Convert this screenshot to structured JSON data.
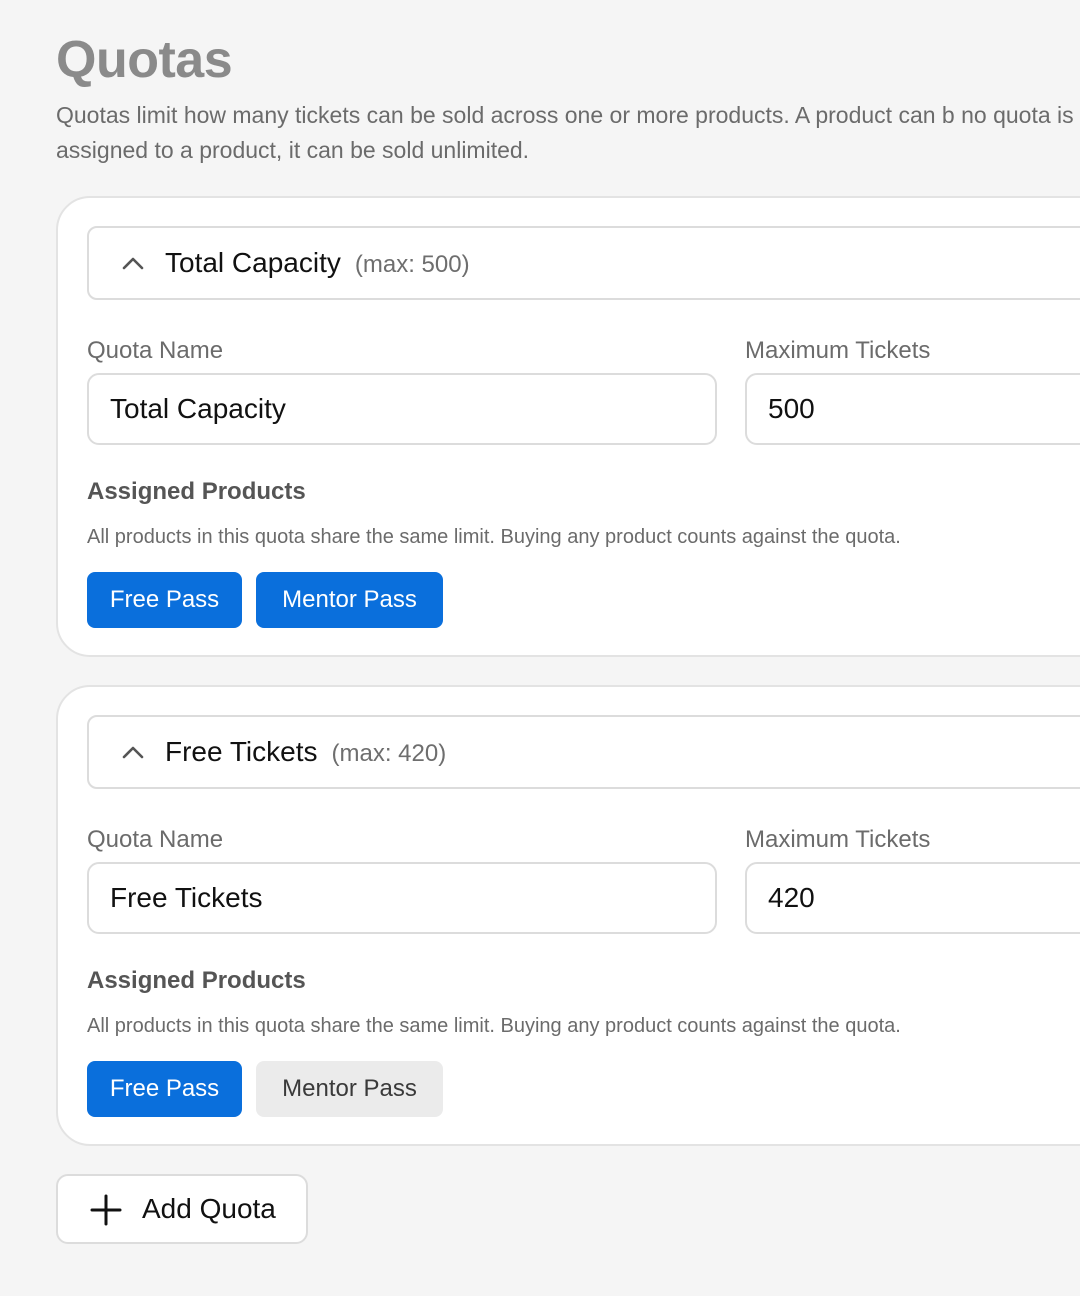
{
  "page": {
    "title": "Quotas",
    "description": "Quotas limit how many tickets can be sold across one or more products. A product can b no quota is assigned to a product, it can be sold unlimited."
  },
  "quotas": [
    {
      "header_title": "Total Capacity",
      "header_max": "(max: 500)",
      "name_label": "Quota Name",
      "name_value": "Total Capacity",
      "max_label": "Maximum Tickets",
      "max_value": "500",
      "products_title": "Assigned Products",
      "products_help": "All products in this quota share the same limit. Buying any product counts against the quota.",
      "products": [
        {
          "label": "Free Pass",
          "selected": true
        },
        {
          "label": "Mentor Pass",
          "selected": true
        }
      ]
    },
    {
      "header_title": "Free Tickets",
      "header_max": "(max: 420)",
      "name_label": "Quota Name",
      "name_value": "Free Tickets",
      "max_label": "Maximum Tickets",
      "max_value": "420",
      "products_title": "Assigned Products",
      "products_help": "All products in this quota share the same limit. Buying any product counts against the quota.",
      "products": [
        {
          "label": "Free Pass",
          "selected": true
        },
        {
          "label": "Mentor Pass",
          "selected": false
        }
      ]
    }
  ],
  "add_button": {
    "label": "Add Quota",
    "icon": "plus-icon"
  },
  "colors": {
    "accent": "#0a6fdc",
    "chip_unselected": "#ebebeb",
    "background": "#f5f5f5"
  }
}
